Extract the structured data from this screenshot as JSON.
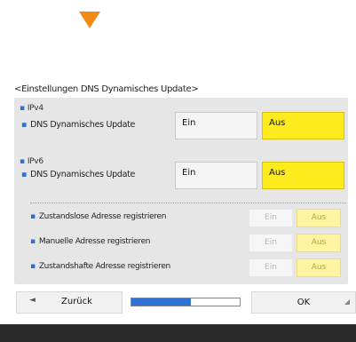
{
  "screen_title": "<Einstellungen DNS Dynamisches Update>",
  "ipv4": {
    "section_label": "IPv4",
    "setting_label": "DNS Dynamisches Update",
    "on_label": "Ein",
    "off_label": "Aus",
    "selected": "Aus"
  },
  "ipv6": {
    "section_label": "IPv6",
    "setting_label": "DNS Dynamisches Update",
    "on_label": "Ein",
    "off_label": "Aus",
    "selected": "Aus",
    "sub_settings": [
      {
        "label": "Zustandslose Adresse registrieren",
        "on_label": "Ein",
        "off_label": "Aus",
        "selected": "Aus",
        "enabled": false
      },
      {
        "label": "Manuelle Adresse registrieren",
        "on_label": "Ein",
        "off_label": "Aus",
        "selected": "Aus",
        "enabled": false
      },
      {
        "label": "Zustandshafte Adresse registrieren",
        "on_label": "Ein",
        "off_label": "Aus",
        "selected": "Aus",
        "enabled": false
      }
    ]
  },
  "footer": {
    "back_label": "Zurück",
    "ok_label": "OK",
    "progress_fraction": 0.55
  },
  "colors": {
    "indicator_arrow": "#f28a16",
    "selected_button": "#ffec1f",
    "bullet": "#2e6fd4",
    "progress_fill": "#2e72d8"
  },
  "icons": {
    "indicator": "down-triangle-icon",
    "back": "back-arrow-icon",
    "ok_corner": "enter-icon"
  }
}
